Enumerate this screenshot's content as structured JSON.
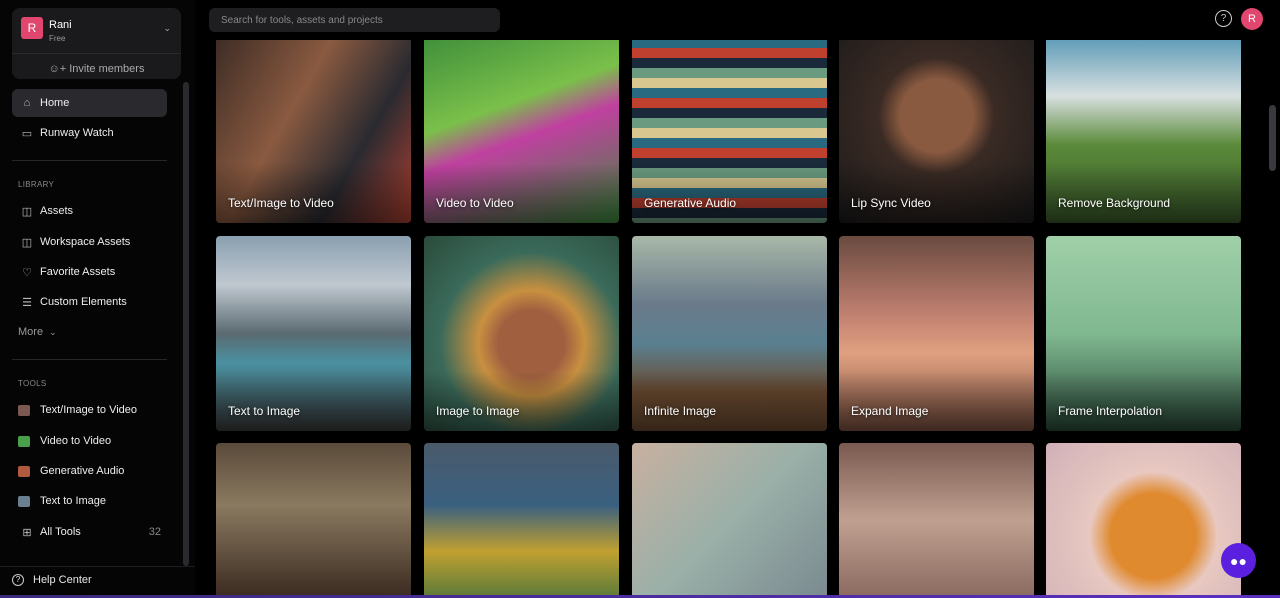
{
  "workspace": {
    "initial": "R",
    "name": "Rani",
    "plan": "Free",
    "invite_label": "Invite members"
  },
  "nav": [
    {
      "label": "Home",
      "icon": "home-icon"
    },
    {
      "label": "Runway Watch",
      "icon": "tv-icon"
    }
  ],
  "library": {
    "title": "LIBRARY",
    "items": [
      {
        "label": "Assets",
        "icon": "folders-icon"
      },
      {
        "label": "Workspace Assets",
        "icon": "folder-share-icon"
      },
      {
        "label": "Favorite Assets",
        "icon": "heart-icon"
      },
      {
        "label": "Custom Elements",
        "icon": "sliders-icon"
      }
    ],
    "more_label": "More"
  },
  "tools": {
    "title": "TOOLS",
    "items": [
      {
        "label": "Text/Image to Video",
        "color": "#7a5a50"
      },
      {
        "label": "Video to Video",
        "color": "#4aa04a"
      },
      {
        "label": "Generative Audio",
        "color": "#b05a40"
      },
      {
        "label": "Text to Image",
        "color": "#6a8090"
      }
    ],
    "all_label": "All Tools",
    "all_count": "32"
  },
  "help_label": "Help Center",
  "header": {
    "search_placeholder": "Search for tools, assets and projects",
    "user_initial": "R"
  },
  "cards": [
    {
      "label": "Text/Image to Video",
      "bg": "linear-gradient(120deg,#3a2a24,#8a5a40 40%,#2a2a30 70%,#b04030)"
    },
    {
      "label": "Video to Video",
      "bg": "linear-gradient(160deg,#3a8a3a,#7ac04a 40%,#c040a0 55%,#3a8a3a)"
    },
    {
      "label": "Generative Audio",
      "bg": "repeating-linear-gradient(180deg,#d8c890 0 10px,#2a6a80 10px 20px,#c04030 20px 30px,#1a2a3a 30px 40px,#6a9a80 40px 50px)"
    },
    {
      "label": "Lip Sync Video",
      "bg": "radial-gradient(circle at 50% 45%,#8a5a40 0 25%,#3a2a24 40%,#1a1a1a)"
    },
    {
      "label": "Remove Background",
      "bg": "linear-gradient(180deg,#4a90b0,#d8e0e0 35%,#5a8a3a 60%,#3a5a2a)"
    },
    {
      "label": "Text to Image",
      "bg": "linear-gradient(180deg,#8aa0b0,#c0c8d0 25%,#5a6a70 50%,#4a90a0 65%,#3a3a3a)"
    },
    {
      "label": "Image to Image",
      "bg": "radial-gradient(circle at 55% 55%,#a06040 0 22%,#c89040 35%,#3a6a5a 60%,#2a4a3a)"
    },
    {
      "label": "Infinite Image",
      "bg": "linear-gradient(180deg,#a8b8a8,#6a7a8a 35%,#5a8090 55%,#6a4a30 80%)"
    },
    {
      "label": "Expand Image",
      "bg": "linear-gradient(180deg,#6a4a40,#c08070 40%,#e0a080 60%,#7a5040)"
    },
    {
      "label": "Frame Interpolation",
      "bg": "linear-gradient(180deg,#a0d0a8,#80b890 50%,#2a4a3a)"
    },
    {
      "label": "",
      "bg": "linear-gradient(180deg,#5a4a3a,#8a7a60 40%,#3a2a20)"
    },
    {
      "label": "",
      "bg": "linear-gradient(180deg,#4a5a6a,#3a6080 40%,#c0a030 70%,#5a7a3a)"
    },
    {
      "label": "",
      "bg": "linear-gradient(135deg,#c8b0a0,#9ab0a8 50%,#7a8a90)"
    },
    {
      "label": "",
      "bg": "linear-gradient(180deg,#7a5a50,#c0a090 50%,#8a6a60)"
    },
    {
      "label": "",
      "bg": "radial-gradient(circle at 55% 60%,#e08a30 0 30%,#e8c8c0 45%,#d0b0b8)"
    }
  ]
}
